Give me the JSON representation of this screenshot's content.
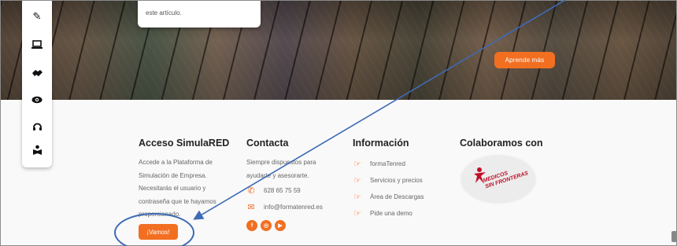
{
  "hero": {
    "card_text": "este artículo.",
    "button_label": "Aprende más"
  },
  "sidebar": {
    "icons": [
      "pencil-icon",
      "laptop-icon",
      "handshake-icon",
      "eye-icon",
      "headset-icon",
      "reader-icon"
    ]
  },
  "footer": {
    "acceso": {
      "title": "Acceso SimulaRED",
      "lines": [
        "Accede a la Plataforma de",
        "Simulación de Empresa.",
        "Necesitarás el usuario y",
        "contraseña que te hayamos",
        "proporcionado."
      ],
      "button_label": "¡Vamos!"
    },
    "contacta": {
      "title": "Contacta",
      "lines": [
        "Siempre dispuestos para",
        "ayudarte y asesorarte."
      ],
      "phone": "628 65 75 59",
      "email": "info@formatenred.es",
      "social": [
        "facebook-icon",
        "instagram-icon",
        "youtube-icon"
      ]
    },
    "informacion": {
      "title": "Información",
      "items": [
        "formaTenred",
        "Servicios y precios",
        "Área de Descargas",
        "Pide una demo"
      ]
    },
    "colaboramos": {
      "title": "Colaboramos con",
      "logo_text": [
        "MEDICOS",
        "SIN FRONTERAS"
      ]
    }
  },
  "colors": {
    "accent": "#f26f21",
    "annotation": "#3e6bb5"
  }
}
